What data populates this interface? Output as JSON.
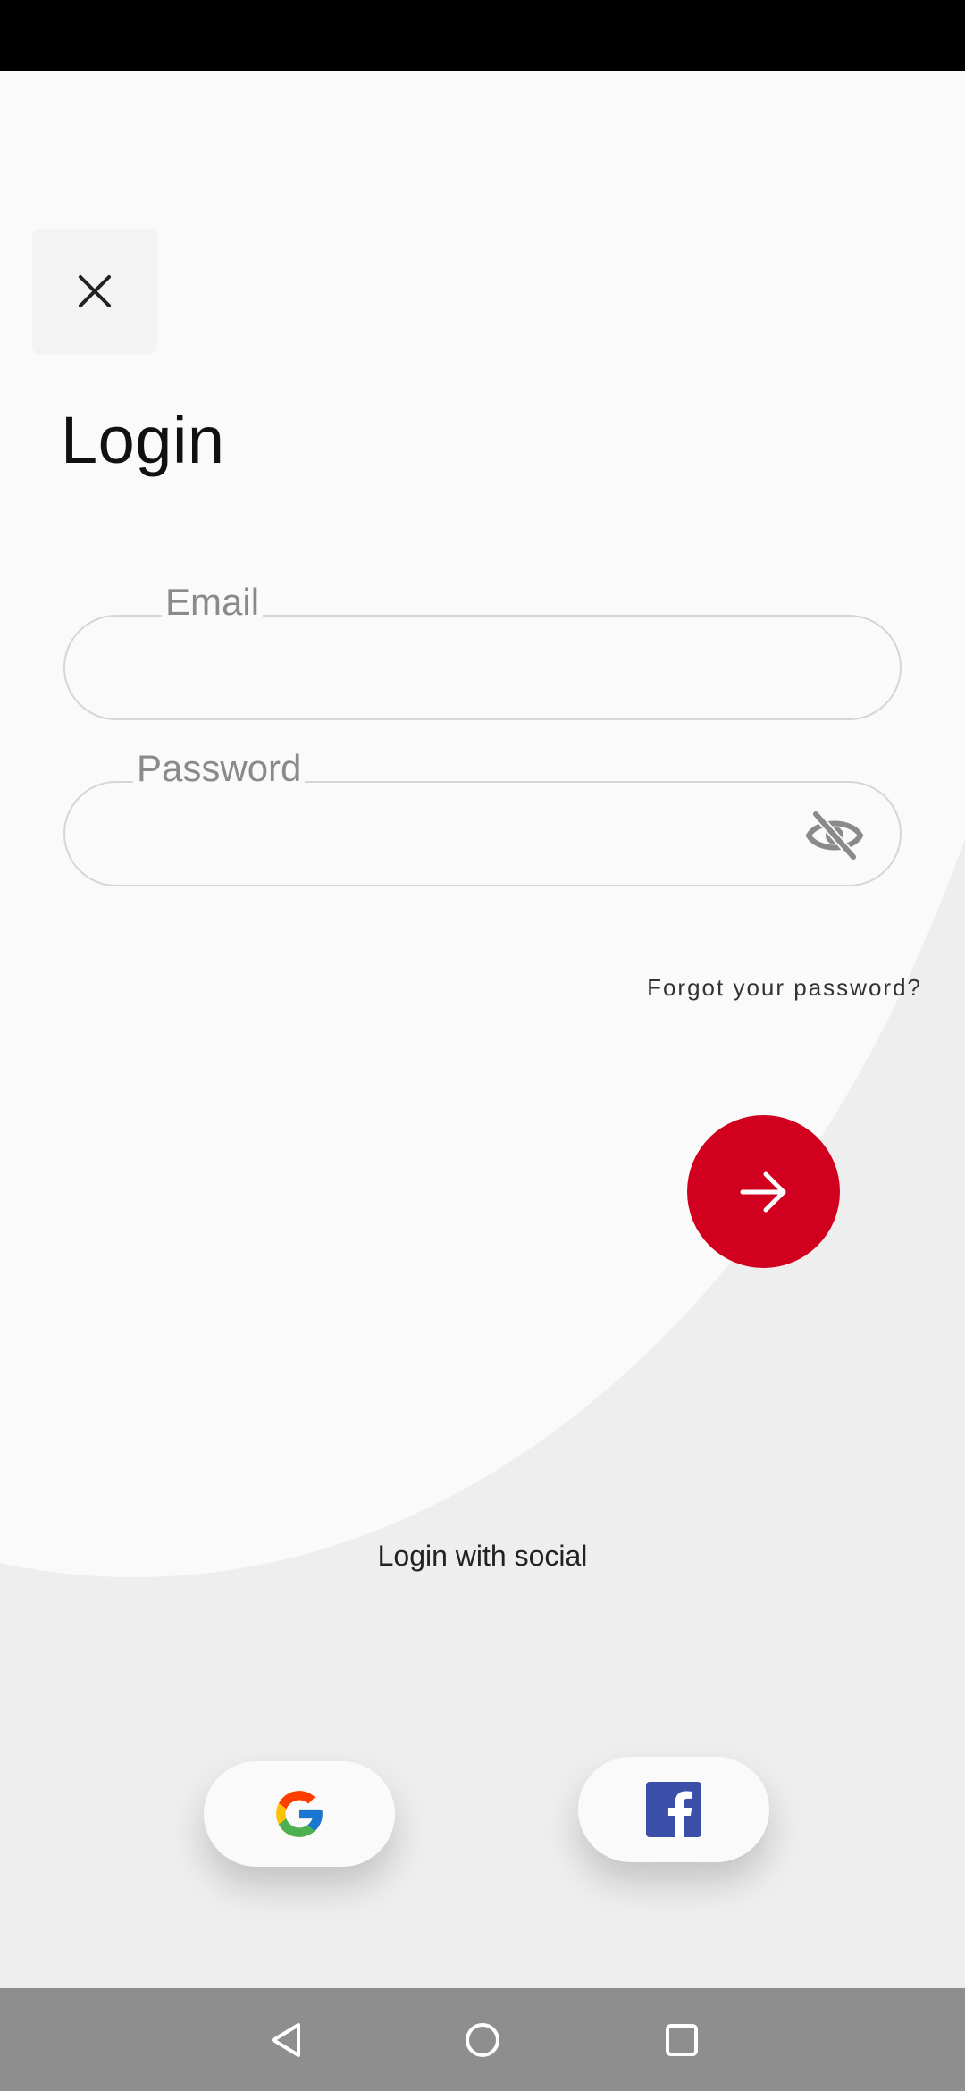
{
  "login": {
    "title": "Login",
    "email_label": "Email",
    "email_value": "",
    "password_label": "Password",
    "password_value": "",
    "forgot_password": "Forgot your password?",
    "social_label": "Login with social"
  },
  "icons": {
    "close": "close-icon",
    "password_visibility": "eye-off-icon",
    "submit": "arrow-right-icon",
    "google": "google-icon",
    "facebook": "facebook-icon",
    "nav_back": "back-triangle-icon",
    "nav_home": "home-circle-icon",
    "nav_recents": "recents-square-icon"
  },
  "colors": {
    "accent": "#d1001f",
    "background": "#eeeeee",
    "card": "#fafafa",
    "facebook": "#3b4fa8"
  }
}
